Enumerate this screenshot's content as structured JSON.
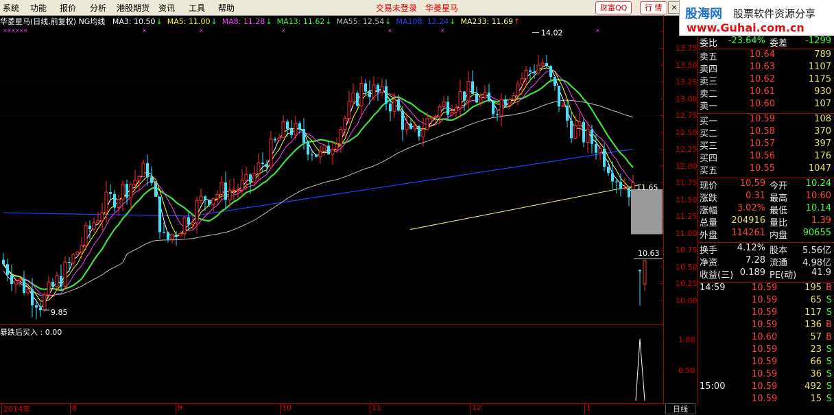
{
  "menu": [
    "系统",
    "功能",
    "报价",
    "分析",
    "港股期货",
    "资讯",
    "工具",
    "帮助"
  ],
  "status": {
    "login": "交易未登录",
    "stock": "华菱星马"
  },
  "buttons": {
    "wealth": "财富QQ",
    "quote": "行 情"
  },
  "brand": {
    "name": "股海网",
    "slogan": "股票软件资源分享",
    "url": "www.Guhai.com.cn"
  },
  "chart_title": "华菱星马(日线,前复权) NG均线",
  "ma": [
    {
      "label": "MA3: 10.50",
      "arrow": "↓",
      "color": "#ffffff"
    },
    {
      "label": "MA5: 11.00",
      "arrow": "↓",
      "color": "#ffff00"
    },
    {
      "label": "MA8: 11.28",
      "arrow": "↓",
      "color": "#ff40ff"
    },
    {
      "label": "MA13: 11.62",
      "arrow": "↓",
      "color": "#40ff40"
    },
    {
      "label": "MA55: 12.54",
      "arrow": "↓",
      "color": "#c0c0c0"
    },
    {
      "label": "MA108: 12.24",
      "arrow": "↓",
      "color": "#2040ff"
    },
    {
      "label": "MA233: 11.69",
      "arrow": "↑",
      "color": "#ffff80"
    }
  ],
  "indicator_title": "暴跌后买入 : 0.00",
  "chart_data": {
    "type": "candlestick",
    "yticks_main": [
      "13.75",
      "13.50",
      "13.25",
      "13.00",
      "12.75",
      "12.50",
      "12.25",
      "12.00",
      "11.75",
      "11.50",
      "11.25",
      "11.00",
      "10.75",
      "10.50",
      "10.25",
      "10.00"
    ],
    "yticks_sub": [
      "1.00",
      "0.50"
    ],
    "xlabels": [
      "2014年",
      "8",
      "9",
      "10",
      "11",
      "12",
      "1"
    ],
    "annotations": {
      "high": "14.02",
      "low": "9.85",
      "mark1": "11.65",
      "mark2": "10.63"
    },
    "ylim": [
      9.85,
      14.05
    ],
    "last_close": 10.59
  },
  "period": "日线",
  "quote": {
    "weibi": {
      "label": "委比",
      "value": "-23.64%",
      "label2": "委差",
      "value2": "-1299"
    },
    "sell": [
      {
        "label": "卖五",
        "price": "10.64",
        "vol": "789"
      },
      {
        "label": "卖四",
        "price": "10.63",
        "vol": "1107"
      },
      {
        "label": "卖三",
        "price": "10.62",
        "vol": "1175"
      },
      {
        "label": "卖二",
        "price": "10.61",
        "vol": "930"
      },
      {
        "label": "卖一",
        "price": "10.60",
        "vol": "107"
      }
    ],
    "buy": [
      {
        "label": "买一",
        "price": "10.59",
        "vol": "108"
      },
      {
        "label": "买二",
        "price": "10.58",
        "vol": "370"
      },
      {
        "label": "买三",
        "price": "10.57",
        "vol": "397"
      },
      {
        "label": "买四",
        "price": "10.56",
        "vol": "176"
      },
      {
        "label": "买五",
        "price": "10.55",
        "vol": "1047"
      }
    ],
    "stats": [
      {
        "l1": "现价",
        "v1": "10.59",
        "l2": "今开",
        "v2": "10.24",
        "c1": "#ff4040",
        "c2": "#40ff40"
      },
      {
        "l1": "涨跌",
        "v1": "0.31",
        "l2": "最高",
        "v2": "10.60",
        "c1": "#ff4040",
        "c2": "#ff4040"
      },
      {
        "l1": "涨幅",
        "v1": "3.02%",
        "l2": "最低",
        "v2": "10.14",
        "c1": "#ff4040",
        "c2": "#40ff40"
      },
      {
        "l1": "总量",
        "v1": "204916",
        "l2": "量比",
        "v2": "1.39",
        "c1": "#e8e060",
        "c2": "#ff4040"
      },
      {
        "l1": "外盘",
        "v1": "114261",
        "l2": "内盘",
        "v2": "90655",
        "c1": "#ff4040",
        "c2": "#40ff40"
      }
    ],
    "info": [
      {
        "l1": "换手",
        "v1": "4.12%",
        "l2": "股本",
        "v2": "5.56亿"
      },
      {
        "l1": "净资",
        "v1": "7.28",
        "l2": "流通",
        "v2": "4.98亿"
      },
      {
        "l1": "收益(三)",
        "v1": "0.189",
        "l2": "PE(动)",
        "v2": "41.9"
      }
    ],
    "ticks": [
      {
        "time": "14:59",
        "price": "10.59",
        "vol": "195",
        "bs": "B"
      },
      {
        "time": "",
        "price": "10.59",
        "vol": "65",
        "bs": "S"
      },
      {
        "time": "",
        "price": "10.59",
        "vol": "117",
        "bs": "S"
      },
      {
        "time": "",
        "price": "10.59",
        "vol": "136",
        "bs": "B"
      },
      {
        "time": "",
        "price": "10.60",
        "vol": "57",
        "bs": "B"
      },
      {
        "time": "",
        "price": "10.59",
        "vol": "23",
        "bs": "S"
      },
      {
        "time": "",
        "price": "10.59",
        "vol": "66",
        "bs": "S"
      },
      {
        "time": "",
        "price": "10.59",
        "vol": "36",
        "bs": "S"
      },
      {
        "time": "15:00",
        "price": "10.59",
        "vol": "492",
        "bs": "S"
      },
      {
        "time": "",
        "price": "10.59",
        "vol": "15",
        "bs": "S"
      }
    ]
  }
}
